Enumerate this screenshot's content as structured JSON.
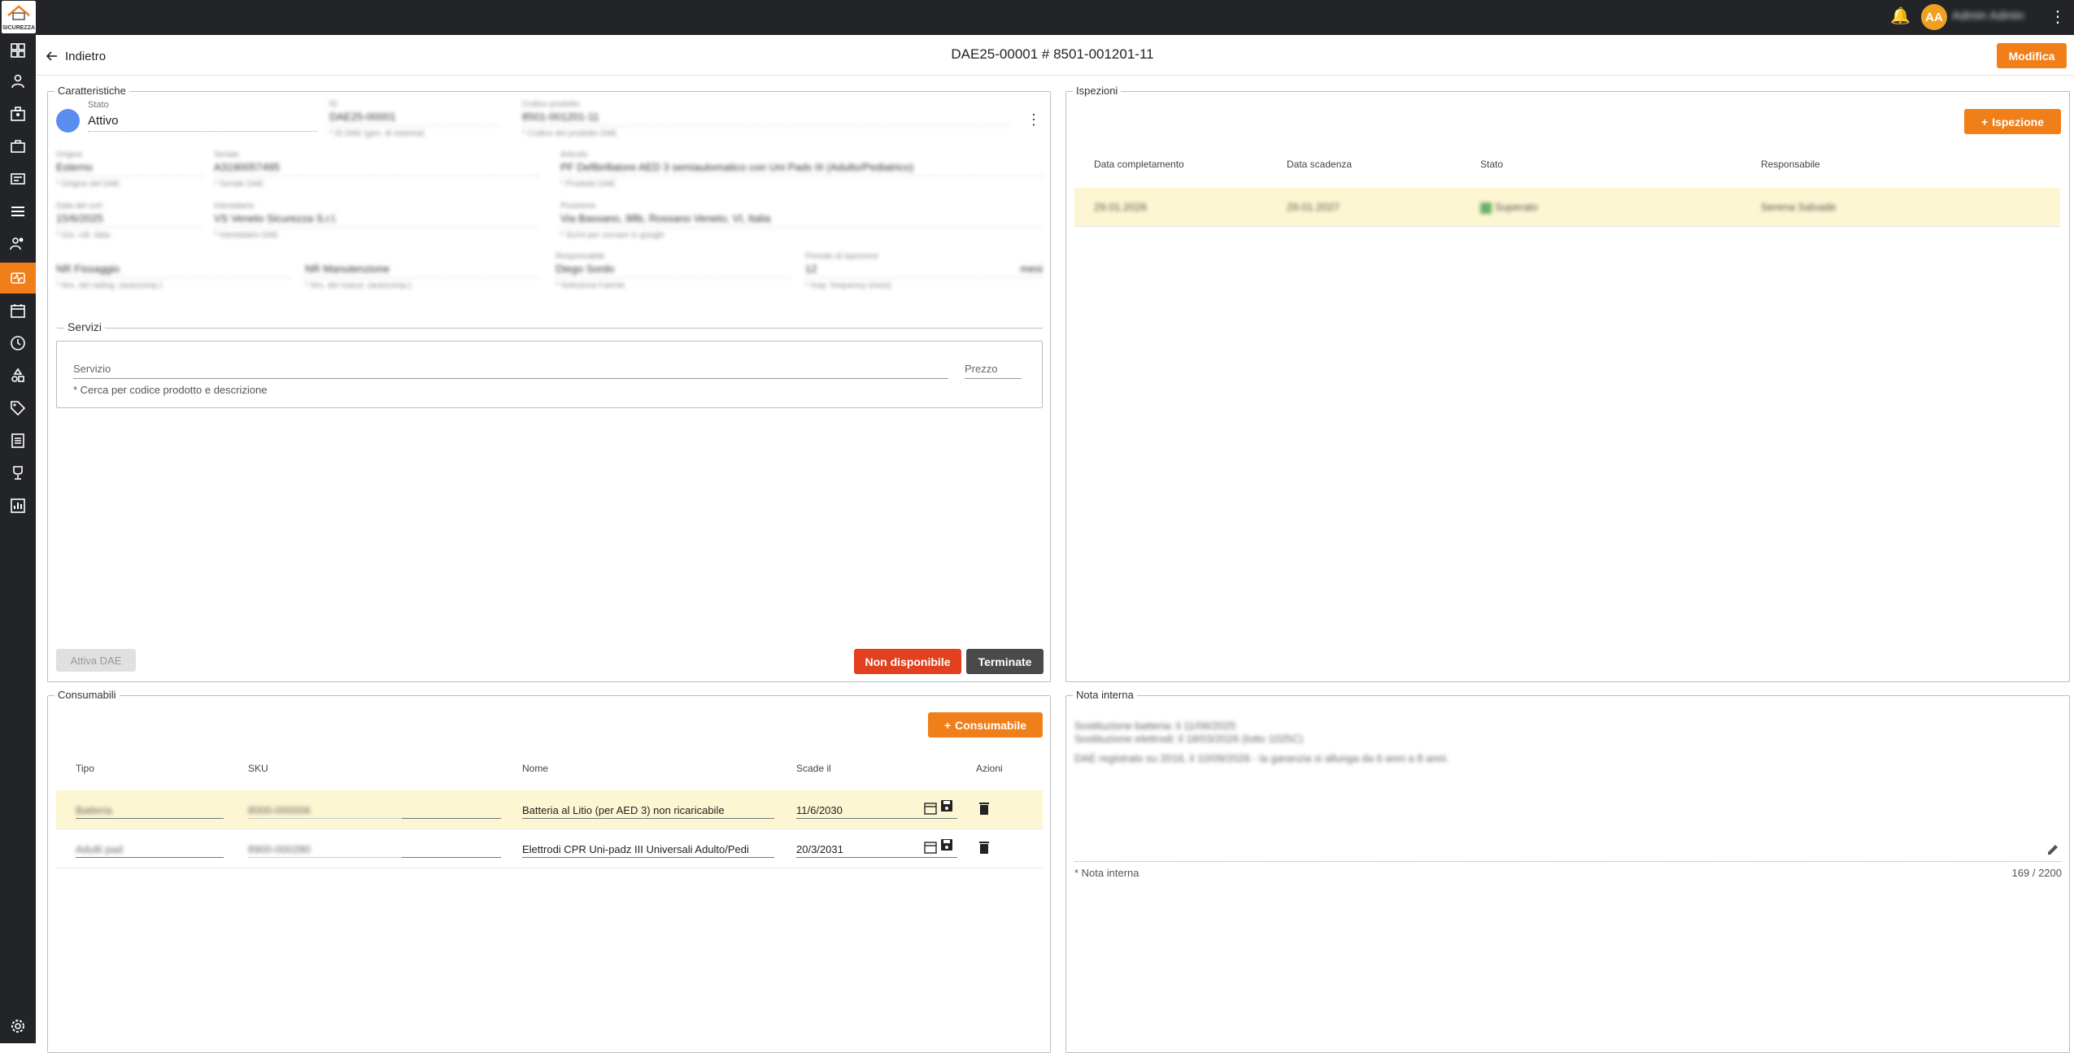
{
  "topbar": {
    "logo_text": "SICUREZZA",
    "avatar_initials": "AA",
    "username": "Admin Admin"
  },
  "sidebar": {
    "items": [
      {
        "icon": "dashboard-icon"
      },
      {
        "icon": "person-icon"
      },
      {
        "icon": "company-icon"
      },
      {
        "icon": "briefcase-icon"
      },
      {
        "icon": "cards-icon"
      },
      {
        "icon": "storage-icon"
      },
      {
        "icon": "users-icon"
      },
      {
        "icon": "defibrillator-icon",
        "active": true
      },
      {
        "icon": "calendar-icon"
      },
      {
        "icon": "clock-icon"
      },
      {
        "icon": "shapes-icon"
      },
      {
        "icon": "tag-icon"
      },
      {
        "icon": "list-icon"
      },
      {
        "icon": "trophy-icon"
      },
      {
        "icon": "report-icon"
      },
      {
        "icon": "settings-icon"
      }
    ],
    "active_color": "#f07f1a"
  },
  "header": {
    "back_label": "Indietro",
    "title": "DAE25-00001 # 8501-001201-11",
    "edit_label": "Modifica"
  },
  "caratteristiche": {
    "legend": "Caratteristiche",
    "stato_label": "Stato",
    "stato_value": "Attivo",
    "id_label": "ID",
    "id_value": "DAE25-00001",
    "id_help": "* ID DAE (gen. di sistema)",
    "codice_label": "Codice prodotto",
    "codice_value": "8501-001201-11",
    "codice_help": "* Codice del prodotto DAE",
    "origine_label": "Origine",
    "origine_value": "Esterno",
    "origine_help": "* Origine del DAE",
    "seriale_label": "Seriale",
    "seriale_value": "A3190057495",
    "seriale_help": "* Seriale DAE",
    "articolo_label": "Articolo",
    "articolo_value": "PF Defibrillatore AED 3 semiautomatico con Uni Pads III (Adulto/Pediatrico)",
    "articolo_help": "* Prodotto DAE",
    "data_label": "Data del cert",
    "data_value": "15/6/2025",
    "data_help": "* Gio. cdt. data",
    "intestatario_label": "Intestatario",
    "intestatario_value": "VS Veneto Sicurezza S.r.l.",
    "intestatario_help": "* Intestatario DAE",
    "posizione_label": "Posizione",
    "posizione_value": "Via Bassano, 98b, Rossano Veneto, VI, Italia",
    "posizione_help": "* Scrivi per cercare in google",
    "nr_fissaggio_label": "NR Fissaggio",
    "nr_fissaggio_help": "* Nrs. del radiog. (autocomp.)",
    "nr_manutenzione_label": "NR Manutenzione",
    "nr_manutenzione_help": "* Nrs. del manut. (autocomp.)",
    "responsabile_label": "Responsabile",
    "responsabile_value": "Diego Sordo",
    "responsabile_help": "* Seleziona l'utente",
    "periodo_label": "Periodo di ispezione",
    "periodo_value": "12",
    "periodo_unit": "mesi",
    "periodo_help": "* Insp. frequency (mesi)"
  },
  "servizi": {
    "legend": "Servizi",
    "servizio_placeholder": "Servizio",
    "prezzo_placeholder": "Prezzo",
    "help": "* Cerca per codice prodotto e descrizione"
  },
  "actions": {
    "attiva": "Attiva DAE",
    "non_disponibile": "Non disponibile",
    "terminate": "Terminate"
  },
  "ispezioni": {
    "legend": "Ispezioni",
    "add_label": "Ispezione",
    "columns": [
      "Data completamento",
      "Data scadenza",
      "Stato",
      "Responsabile"
    ],
    "rows": [
      {
        "completamento": "29.01.2026",
        "scadenza": "29.01.2027",
        "stato": "Superato",
        "responsabile": "Serena Salvade"
      }
    ]
  },
  "consumabili": {
    "legend": "Consumabili",
    "add_label": "Consumabile",
    "columns": [
      "Tipo",
      "SKU",
      "Nome",
      "Scade il",
      "Azioni"
    ],
    "rows": [
      {
        "tipo": "Batteria",
        "sku": "8000-000006",
        "nome": "Batteria al Litio (per AED 3) non ricaricabile",
        "scade": "11/6/2030"
      },
      {
        "tipo": "Adulti pad",
        "sku": "8900-000280",
        "nome": "Elettrodi CPR Uni-padz III  Universali Adulto/Pedi",
        "scade": "20/3/2031"
      }
    ]
  },
  "nota": {
    "legend": "Nota interna",
    "text_line1": "Sostituzione batteria: il 11/06/2025",
    "text_line2": "Sostituzione elettrodi: il 18/03/2026 (lotto 1025C)",
    "text_line3": "DAE registrato su 2016, il 10/09/2026 - la garanzia si allunga da 6 anni a 8 anni.",
    "label": "* Nota interna",
    "count": "169 / 2200"
  }
}
